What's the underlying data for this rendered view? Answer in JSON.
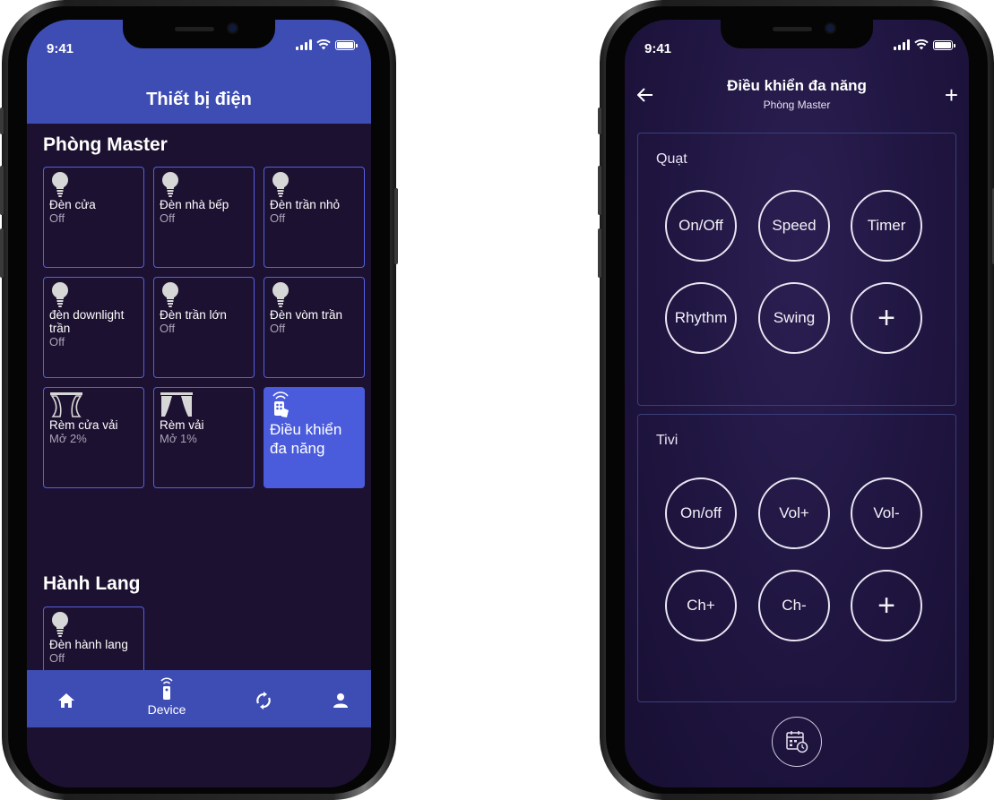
{
  "left_phone": {
    "status": {
      "time": "9:41"
    },
    "header": {
      "title": "Thiết bị điện"
    },
    "sections": [
      {
        "title": "Phòng Master",
        "devices": [
          {
            "name": "Đèn cửa",
            "status": "Off",
            "icon": "bulb-icon"
          },
          {
            "name": "Đèn nhà bếp",
            "status": "Off",
            "icon": "bulb-icon"
          },
          {
            "name": "Đèn trần nhỏ",
            "status": "Off",
            "icon": "bulb-icon"
          },
          {
            "name": "đèn downlight trần",
            "status": "Off",
            "icon": "bulb-icon"
          },
          {
            "name": "Đèn trần lớn",
            "status": "Off",
            "icon": "bulb-icon"
          },
          {
            "name": "Đèn vòm trần",
            "status": "Off",
            "icon": "bulb-icon"
          },
          {
            "name": "Rèm cửa vải",
            "status": "Mở 2%",
            "icon": "curtain-icon"
          },
          {
            "name": "Rèm vải",
            "status": "Mở 1%",
            "icon": "curtain-icon"
          },
          {
            "name": "Điều khiển đa năng",
            "status": "",
            "icon": "remote-icon",
            "active": true
          }
        ]
      },
      {
        "title": "Hành Lang",
        "devices": [
          {
            "name": "Đèn hành lang",
            "status": "Off",
            "icon": "bulb-icon"
          }
        ]
      }
    ],
    "bottom_nav": [
      {
        "icon": "home-icon",
        "label": ""
      },
      {
        "icon": "remote-icon",
        "label": "Device"
      },
      {
        "icon": "sync-icon",
        "label": ""
      },
      {
        "icon": "user-icon",
        "label": ""
      }
    ]
  },
  "right_phone": {
    "status": {
      "time": "9:41"
    },
    "header": {
      "title": "Điều khiển đa năng",
      "subtitle": "Phòng Master",
      "back_icon": "arrow-left-icon",
      "add_label": "+"
    },
    "panels": [
      {
        "label": "Quạt",
        "buttons": [
          "On/Off",
          "Speed",
          "Timer",
          "Rhythm",
          "Swing",
          "+"
        ]
      },
      {
        "label": "Tivi",
        "buttons": [
          "On/off",
          "Vol+",
          "Vol-",
          "Ch+",
          "Ch-",
          "+"
        ]
      }
    ],
    "schedule_icon": "calendar-clock-icon",
    "colors": {
      "accent": "#3e4db4",
      "active_tile": "#4a5bdc",
      "background": "#1c1130"
    }
  }
}
